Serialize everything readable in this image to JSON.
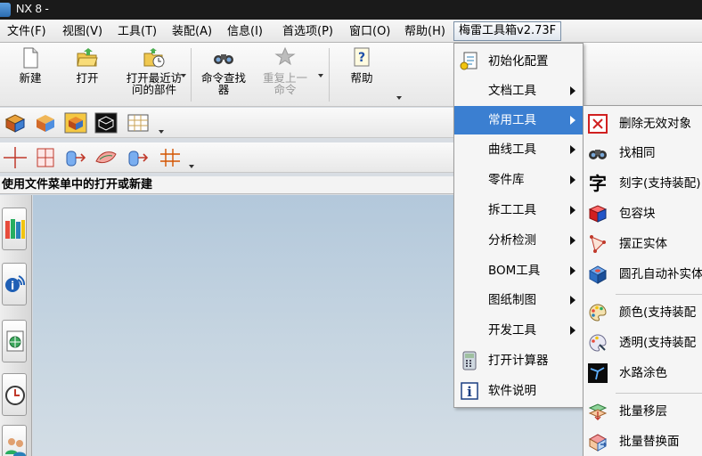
{
  "window": {
    "title": "NX 8 -"
  },
  "menubar": {
    "items": [
      {
        "label": "文件(F)"
      },
      {
        "label": "视图(V)"
      },
      {
        "label": "工具(T)"
      },
      {
        "label": "装配(A)"
      },
      {
        "label": "信息(I)"
      },
      {
        "label": "首选项(P)"
      },
      {
        "label": "窗口(O)"
      },
      {
        "label": "帮助(H)"
      },
      {
        "label": "梅雷工具箱v2.73F"
      }
    ]
  },
  "ribbon": {
    "new": "新建",
    "open": "打开",
    "recent_line1": "打开最近访",
    "recent_line2": "问的部件",
    "command_finder_line1": "命令查找",
    "command_finder_line2": "器",
    "repeat_line1": "重复上一",
    "repeat_line2": "命令",
    "help": "帮助"
  },
  "cue_line": "使用文件菜单中的打开或新建",
  "toolbox_menu": {
    "items": [
      {
        "label": "初始化配置",
        "icon": "config-icon"
      },
      {
        "label": "文档工具",
        "has_submenu": true
      },
      {
        "label": "常用工具",
        "has_submenu": true,
        "highlighted": true
      },
      {
        "label": "曲线工具",
        "has_submenu": true
      },
      {
        "label": "零件库",
        "has_submenu": true
      },
      {
        "label": "拆工工具",
        "has_submenu": true
      },
      {
        "label": "分析检测",
        "has_submenu": true
      },
      {
        "label": "BOM工具",
        "has_submenu": true
      },
      {
        "label": "图纸制图",
        "has_submenu": true
      },
      {
        "label": "开发工具",
        "has_submenu": true
      },
      {
        "label": "打开计算器",
        "icon": "calculator-icon"
      },
      {
        "label": "软件说明",
        "icon": "info-icon"
      }
    ]
  },
  "common_tools_submenu": {
    "items": [
      {
        "label": "删除无效对象",
        "icon": "delete-invalid-icon"
      },
      {
        "label": "找相同",
        "icon": "binoculars-icon"
      },
      {
        "label": "刻字(支持装配)",
        "icon": "text-char-icon",
        "glyph": "字"
      },
      {
        "label": "包容块",
        "icon": "bounding-block-icon"
      },
      {
        "label": "摆正实体",
        "icon": "align-solid-icon"
      },
      {
        "label": "圆孔自动补实体",
        "icon": "hole-fill-icon"
      },
      {
        "label": "颜色(支持装配",
        "icon": "palette-icon"
      },
      {
        "label": "透明(支持装配",
        "icon": "transparency-icon"
      },
      {
        "label": "水路涂色",
        "icon": "waterline-icon"
      },
      {
        "label": "批量移层",
        "icon": "move-layer-icon"
      },
      {
        "label": "批量替换面",
        "icon": "replace-face-icon"
      }
    ]
  },
  "colors": {
    "highlight": "#3b7fd1",
    "title_bar": "#1a1a1a",
    "graphics_bg": "#c6d5e1"
  }
}
